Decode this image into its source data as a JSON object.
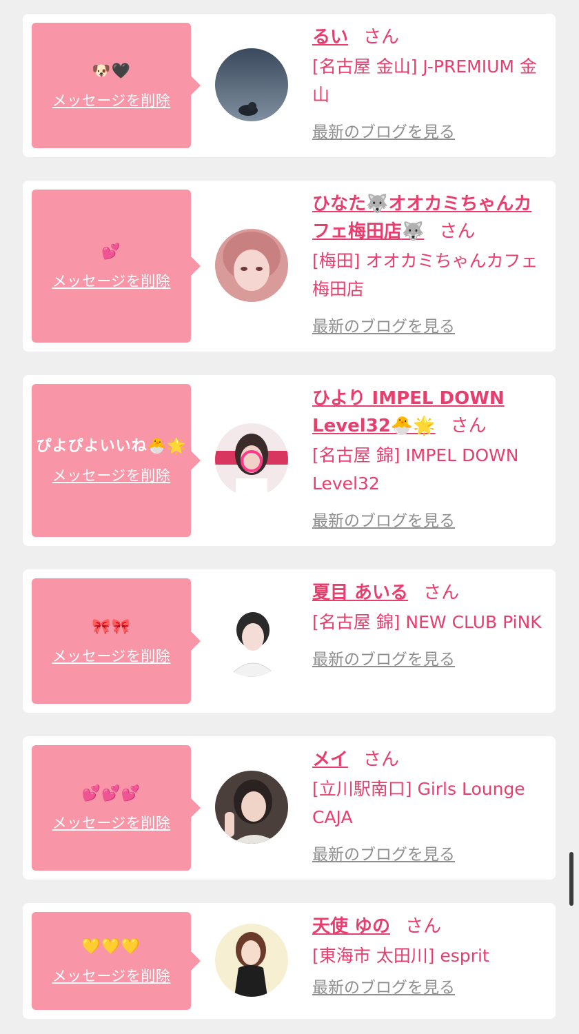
{
  "delete_label": "メッセージを削除",
  "blog_label": "最新のブログを見る",
  "san_label": "さん",
  "cards": [
    {
      "message": "🐶🖤",
      "name": "るい",
      "shop": "[名古屋 金山] J-PREMIUM 金山"
    },
    {
      "message": "💕",
      "name": "ひなた🐺オオカミちゃんカフェ梅田店🐺",
      "shop": "[梅田] オオカミちゃんカフェ梅田店"
    },
    {
      "message": "ぴよぴよいいね🐣🌟",
      "name": "ひより IMPEL DOWN Level32🐣🌟",
      "shop": "[名古屋 錦] IMPEL DOWN Level32"
    },
    {
      "message": "🎀🎀",
      "name": "夏目 あいる",
      "shop": "[名古屋 錦] NEW CLUB PiNK"
    },
    {
      "message": "💕💕💕",
      "name": "メイ",
      "shop": "[立川駅南口] Girls Lounge CAJA"
    },
    {
      "message": "💛💛💛",
      "name": "天使 ゆの",
      "shop": "[東海市 太田川] esprit"
    }
  ],
  "colors": {
    "accent": "#e83e6e",
    "message_bg": "#f895a6",
    "page_bg": "#efefef",
    "link_gray": "#8f8f8f"
  }
}
